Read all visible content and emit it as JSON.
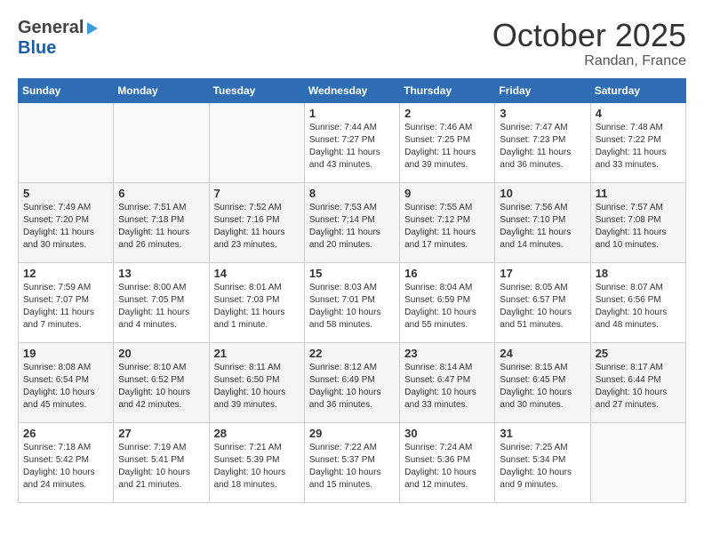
{
  "header": {
    "logo_general": "General",
    "logo_blue": "Blue",
    "month": "October 2025",
    "location": "Randan, France"
  },
  "days_of_week": [
    "Sunday",
    "Monday",
    "Tuesday",
    "Wednesday",
    "Thursday",
    "Friday",
    "Saturday"
  ],
  "weeks": [
    [
      {
        "day": "",
        "content": ""
      },
      {
        "day": "",
        "content": ""
      },
      {
        "day": "",
        "content": ""
      },
      {
        "day": "1",
        "content": "Sunrise: 7:44 AM\nSunset: 7:27 PM\nDaylight: 11 hours\nand 43 minutes."
      },
      {
        "day": "2",
        "content": "Sunrise: 7:46 AM\nSunset: 7:25 PM\nDaylight: 11 hours\nand 39 minutes."
      },
      {
        "day": "3",
        "content": "Sunrise: 7:47 AM\nSunset: 7:23 PM\nDaylight: 11 hours\nand 36 minutes."
      },
      {
        "day": "4",
        "content": "Sunrise: 7:48 AM\nSunset: 7:22 PM\nDaylight: 11 hours\nand 33 minutes."
      }
    ],
    [
      {
        "day": "5",
        "content": "Sunrise: 7:49 AM\nSunset: 7:20 PM\nDaylight: 11 hours\nand 30 minutes."
      },
      {
        "day": "6",
        "content": "Sunrise: 7:51 AM\nSunset: 7:18 PM\nDaylight: 11 hours\nand 26 minutes."
      },
      {
        "day": "7",
        "content": "Sunrise: 7:52 AM\nSunset: 7:16 PM\nDaylight: 11 hours\nand 23 minutes."
      },
      {
        "day": "8",
        "content": "Sunrise: 7:53 AM\nSunset: 7:14 PM\nDaylight: 11 hours\nand 20 minutes."
      },
      {
        "day": "9",
        "content": "Sunrise: 7:55 AM\nSunset: 7:12 PM\nDaylight: 11 hours\nand 17 minutes."
      },
      {
        "day": "10",
        "content": "Sunrise: 7:56 AM\nSunset: 7:10 PM\nDaylight: 11 hours\nand 14 minutes."
      },
      {
        "day": "11",
        "content": "Sunrise: 7:57 AM\nSunset: 7:08 PM\nDaylight: 11 hours\nand 10 minutes."
      }
    ],
    [
      {
        "day": "12",
        "content": "Sunrise: 7:59 AM\nSunset: 7:07 PM\nDaylight: 11 hours\nand 7 minutes."
      },
      {
        "day": "13",
        "content": "Sunrise: 8:00 AM\nSunset: 7:05 PM\nDaylight: 11 hours\nand 4 minutes."
      },
      {
        "day": "14",
        "content": "Sunrise: 8:01 AM\nSunset: 7:03 PM\nDaylight: 11 hours\nand 1 minute."
      },
      {
        "day": "15",
        "content": "Sunrise: 8:03 AM\nSunset: 7:01 PM\nDaylight: 10 hours\nand 58 minutes."
      },
      {
        "day": "16",
        "content": "Sunrise: 8:04 AM\nSunset: 6:59 PM\nDaylight: 10 hours\nand 55 minutes."
      },
      {
        "day": "17",
        "content": "Sunrise: 8:05 AM\nSunset: 6:57 PM\nDaylight: 10 hours\nand 51 minutes."
      },
      {
        "day": "18",
        "content": "Sunrise: 8:07 AM\nSunset: 6:56 PM\nDaylight: 10 hours\nand 48 minutes."
      }
    ],
    [
      {
        "day": "19",
        "content": "Sunrise: 8:08 AM\nSunset: 6:54 PM\nDaylight: 10 hours\nand 45 minutes."
      },
      {
        "day": "20",
        "content": "Sunrise: 8:10 AM\nSunset: 6:52 PM\nDaylight: 10 hours\nand 42 minutes."
      },
      {
        "day": "21",
        "content": "Sunrise: 8:11 AM\nSunset: 6:50 PM\nDaylight: 10 hours\nand 39 minutes."
      },
      {
        "day": "22",
        "content": "Sunrise: 8:12 AM\nSunset: 6:49 PM\nDaylight: 10 hours\nand 36 minutes."
      },
      {
        "day": "23",
        "content": "Sunrise: 8:14 AM\nSunset: 6:47 PM\nDaylight: 10 hours\nand 33 minutes."
      },
      {
        "day": "24",
        "content": "Sunrise: 8:15 AM\nSunset: 6:45 PM\nDaylight: 10 hours\nand 30 minutes."
      },
      {
        "day": "25",
        "content": "Sunrise: 8:17 AM\nSunset: 6:44 PM\nDaylight: 10 hours\nand 27 minutes."
      }
    ],
    [
      {
        "day": "26",
        "content": "Sunrise: 7:18 AM\nSunset: 5:42 PM\nDaylight: 10 hours\nand 24 minutes."
      },
      {
        "day": "27",
        "content": "Sunrise: 7:19 AM\nSunset: 5:41 PM\nDaylight: 10 hours\nand 21 minutes."
      },
      {
        "day": "28",
        "content": "Sunrise: 7:21 AM\nSunset: 5:39 PM\nDaylight: 10 hours\nand 18 minutes."
      },
      {
        "day": "29",
        "content": "Sunrise: 7:22 AM\nSunset: 5:37 PM\nDaylight: 10 hours\nand 15 minutes."
      },
      {
        "day": "30",
        "content": "Sunrise: 7:24 AM\nSunset: 5:36 PM\nDaylight: 10 hours\nand 12 minutes."
      },
      {
        "day": "31",
        "content": "Sunrise: 7:25 AM\nSunset: 5:34 PM\nDaylight: 10 hours\nand 9 minutes."
      },
      {
        "day": "",
        "content": ""
      }
    ]
  ]
}
